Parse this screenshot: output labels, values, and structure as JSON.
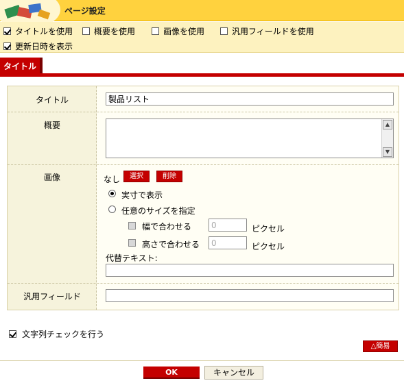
{
  "header": {
    "title": "ページ設定"
  },
  "options": [
    {
      "label": "タイトルを使用",
      "checked": true
    },
    {
      "label": "概要を使用",
      "checked": false
    },
    {
      "label": "画像を使用",
      "checked": false
    },
    {
      "label": "汎用フィールドを使用",
      "checked": false
    },
    {
      "label": "更新日時を表示",
      "checked": true
    }
  ],
  "tab": {
    "label": "タイトル"
  },
  "form": {
    "title_label": "タイトル",
    "title_value": "製品リスト",
    "summary_label": "概要",
    "summary_value": "",
    "image_label": "画像",
    "image_none": "なし",
    "select_button": "選択",
    "delete_button": "削除",
    "radio_actual": "実寸で表示",
    "radio_custom": "任意のサイズを指定",
    "fit_width_label": "幅で合わせる",
    "fit_width_value": "0",
    "fit_height_label": "高さで合わせる",
    "fit_height_value": "0",
    "pixel_unit": "ピクセル",
    "alt_text_label": "代替テキスト:",
    "alt_text_value": "",
    "generic_label": "汎用フィールド",
    "generic_value": ""
  },
  "string_check": {
    "label": "文字列チェックを行う",
    "checked": true
  },
  "simple_button": "△簡易",
  "footer": {
    "ok": "OK",
    "cancel": "キャンセル"
  },
  "colors": {
    "accent_red": "#c40000",
    "header_yellow": "#ffd23e",
    "option_bar": "#fdf2bf"
  }
}
